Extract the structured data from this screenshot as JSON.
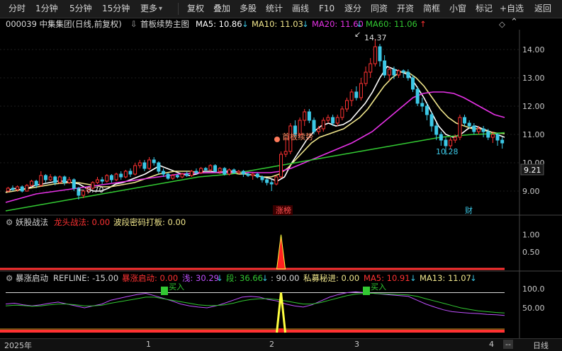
{
  "toolbar": {
    "left": [
      "分时",
      "1分钟",
      "5分钟",
      "15分钟",
      "更多"
    ],
    "more_arrow": "▾",
    "right": [
      "复权",
      "叠加",
      "多股",
      "统计",
      "画线",
      "F10",
      "逐分",
      "同资",
      "开资",
      "简框",
      "小窗",
      "标记",
      "+自选",
      "返回"
    ]
  },
  "main_title": {
    "stock": "000039 中集集团(日线,前复权)",
    "indicator": "首板续势主图",
    "ma5": "MA5: 10.86",
    "ma5_arrow": "↓",
    "ma10": "MA10: 11.03",
    "ma10_arrow": "↓",
    "ma20": "MA20: 11.60",
    "ma20_arrow": "↓",
    "ma60": "MA60: 11.06",
    "ma60_arrow": "↑"
  },
  "sub1_title": {
    "name": "妖股战法",
    "dragon": "龙头战法: 0.00",
    "wave": "波段密码打板: 0.00"
  },
  "sub2_title": {
    "name": "暴涨启动",
    "refline": "REFLINE: -15.00",
    "surge": "暴涨启动: 0.00",
    "shallow": "浅: 30.29",
    "shallow_arrow": "↓",
    "segment": "段: 36.66",
    "segment_arrow": "↓",
    "ninety": ": 90.00",
    "private": "私募秘进: 0.00",
    "ma5": "MA5: 10.91",
    "ma5_arrow": "↓",
    "ma13": "MA13: 11.07",
    "ma13_arrow": "↓"
  },
  "annotations": {
    "high": "14.37",
    "low_left": "8.70",
    "low_right": "10.28",
    "signal": "首板续势",
    "marker_limit": "涨榜",
    "marker_fin": "财",
    "current_price": "9.21",
    "buy_tag": "买入",
    "indicator_symbol": "◇"
  },
  "price_axis": [
    "14.00",
    "13.00",
    "12.00",
    "11.00",
    "10.00",
    "9.00"
  ],
  "sub1_axis": [
    "1.00",
    "0.50"
  ],
  "sub2_axis": [
    "100.0",
    "50.00"
  ],
  "dates": [
    "2025年",
    "1",
    "2",
    "3",
    "4"
  ],
  "date_right": "--",
  "daily_line_label": "日线",
  "colors": {
    "up": "#ff3232",
    "down": "#3cc8e6",
    "ma5": "#ffffff",
    "ma10": "#f0e68c",
    "ma20": "#e632e6",
    "ma60": "#32c832"
  },
  "chart_data": {
    "type": "candlestick",
    "price_ylim": [
      8.2,
      14.7
    ],
    "candles": [
      [
        9.0,
        9.1,
        9.15,
        8.95
      ],
      [
        9.1,
        9.05,
        9.2,
        9.0
      ],
      [
        9.05,
        9.15,
        9.2,
        8.98
      ],
      [
        9.15,
        9.0,
        9.2,
        8.95
      ],
      [
        9.0,
        9.2,
        9.25,
        8.98
      ],
      [
        9.2,
        9.35,
        9.4,
        9.15
      ],
      [
        9.35,
        9.2,
        9.4,
        9.1
      ],
      [
        9.2,
        9.55,
        9.7,
        9.15
      ],
      [
        9.55,
        9.4,
        9.6,
        9.3
      ],
      [
        9.4,
        9.5,
        9.6,
        9.35
      ],
      [
        9.5,
        9.3,
        9.55,
        9.2
      ],
      [
        9.3,
        9.5,
        9.55,
        9.25
      ],
      [
        9.5,
        9.3,
        9.55,
        9.2
      ],
      [
        9.3,
        9.4,
        9.5,
        9.25
      ],
      [
        9.4,
        9.1,
        9.45,
        9.0
      ],
      [
        9.1,
        8.85,
        9.15,
        8.7
      ],
      [
        8.85,
        9.0,
        9.05,
        8.75
      ],
      [
        9.0,
        9.1,
        9.15,
        8.9
      ],
      [
        9.1,
        9.3,
        9.35,
        9.05
      ],
      [
        9.3,
        9.4,
        9.5,
        9.25
      ],
      [
        9.4,
        9.35,
        9.5,
        9.25
      ],
      [
        9.35,
        9.55,
        9.6,
        9.3
      ],
      [
        9.55,
        9.4,
        9.6,
        9.3
      ],
      [
        9.4,
        9.6,
        9.65,
        9.35
      ],
      [
        9.6,
        9.5,
        9.7,
        9.4
      ],
      [
        9.5,
        9.7,
        9.75,
        9.45
      ],
      [
        9.7,
        9.6,
        9.8,
        9.5
      ],
      [
        9.6,
        9.9,
        10.0,
        9.55
      ],
      [
        9.9,
        10.0,
        10.1,
        9.8
      ],
      [
        10.0,
        9.8,
        10.1,
        9.7
      ],
      [
        9.8,
        10.1,
        10.2,
        9.75
      ],
      [
        10.1,
        10.0,
        10.2,
        9.9
      ],
      [
        10.0,
        9.7,
        10.05,
        9.6
      ],
      [
        9.7,
        9.6,
        9.8,
        9.5
      ],
      [
        9.6,
        9.45,
        9.65,
        9.4
      ],
      [
        9.45,
        9.55,
        9.6,
        9.4
      ],
      [
        9.55,
        9.5,
        9.6,
        9.45
      ],
      [
        9.5,
        9.6,
        9.65,
        9.45
      ],
      [
        9.6,
        9.55,
        9.7,
        9.5
      ],
      [
        9.55,
        9.7,
        9.75,
        9.5
      ],
      [
        9.7,
        9.65,
        9.8,
        9.6
      ],
      [
        9.65,
        9.8,
        9.85,
        9.6
      ],
      [
        9.8,
        9.75,
        9.85,
        9.7
      ],
      [
        9.75,
        9.9,
        9.95,
        9.7
      ],
      [
        9.9,
        9.7,
        9.95,
        9.65
      ],
      [
        9.7,
        9.8,
        9.85,
        9.6
      ],
      [
        9.8,
        9.6,
        9.85,
        9.55
      ],
      [
        9.6,
        9.75,
        9.8,
        9.55
      ],
      [
        9.75,
        9.65,
        9.8,
        9.6
      ],
      [
        9.65,
        9.7,
        9.75,
        9.6
      ],
      [
        9.7,
        9.6,
        9.75,
        9.5
      ],
      [
        9.6,
        9.55,
        9.65,
        9.5
      ],
      [
        9.55,
        9.6,
        9.65,
        9.4
      ],
      [
        9.6,
        9.5,
        9.65,
        9.45
      ],
      [
        9.5,
        9.4,
        9.55,
        9.3
      ],
      [
        9.4,
        9.3,
        9.45,
        9.2
      ],
      [
        9.3,
        9.25,
        9.4,
        9.0
      ],
      [
        9.25,
        9.5,
        9.55,
        9.2
      ],
      [
        9.5,
        10.3,
        10.4,
        9.45
      ],
      [
        10.3,
        10.4,
        10.9,
        10.2
      ],
      [
        10.4,
        11.3,
        11.4,
        10.3
      ],
      [
        11.3,
        11.0,
        11.5,
        10.9
      ],
      [
        11.0,
        11.5,
        11.6,
        10.9
      ],
      [
        11.5,
        11.8,
        11.9,
        11.3
      ],
      [
        11.8,
        11.5,
        11.9,
        11.4
      ],
      [
        11.5,
        11.1,
        11.6,
        11.0
      ],
      [
        11.1,
        11.2,
        11.3,
        11.0
      ],
      [
        11.2,
        11.5,
        11.6,
        11.1
      ],
      [
        11.5,
        11.6,
        11.7,
        11.4
      ],
      [
        11.6,
        11.4,
        11.7,
        11.3
      ],
      [
        11.4,
        11.6,
        11.7,
        11.3
      ],
      [
        11.6,
        11.9,
        12.0,
        11.5
      ],
      [
        11.9,
        12.2,
        12.3,
        11.8
      ],
      [
        12.2,
        12.5,
        12.6,
        12.0
      ],
      [
        12.5,
        12.3,
        12.7,
        12.2
      ],
      [
        12.3,
        12.8,
        13.0,
        12.2
      ],
      [
        12.8,
        13.2,
        13.4,
        12.7
      ],
      [
        13.2,
        13.5,
        13.7,
        13.0
      ],
      [
        13.5,
        14.1,
        14.37,
        13.4
      ],
      [
        14.1,
        13.6,
        14.2,
        13.4
      ],
      [
        13.6,
        13.1,
        13.8,
        13.0
      ],
      [
        13.1,
        13.3,
        13.4,
        12.9
      ],
      [
        13.3,
        13.1,
        13.4,
        12.95
      ],
      [
        13.1,
        13.25,
        13.3,
        13.0
      ],
      [
        13.25,
        13.2,
        13.3,
        13.0
      ],
      [
        13.2,
        13.0,
        13.3,
        12.9
      ],
      [
        13.0,
        12.6,
        13.1,
        12.5
      ],
      [
        12.6,
        12.1,
        12.7,
        12.0
      ],
      [
        12.1,
        12.0,
        12.3,
        11.8
      ],
      [
        12.0,
        11.7,
        12.1,
        11.5
      ],
      [
        11.7,
        11.3,
        11.8,
        11.1
      ],
      [
        11.3,
        11.0,
        11.4,
        10.8
      ],
      [
        11.0,
        10.8,
        11.1,
        10.6
      ],
      [
        10.8,
        10.6,
        10.9,
        10.28
      ],
      [
        10.6,
        10.8,
        10.9,
        10.5
      ],
      [
        10.8,
        10.9,
        11.0,
        10.7
      ],
      [
        10.9,
        11.6,
        11.7,
        10.8
      ],
      [
        11.6,
        11.4,
        11.7,
        11.3
      ],
      [
        11.4,
        11.3,
        11.5,
        11.2
      ],
      [
        11.3,
        11.1,
        11.4,
        11.0
      ],
      [
        11.1,
        11.2,
        11.3,
        11.0
      ],
      [
        11.2,
        11.1,
        11.3,
        10.9
      ],
      [
        11.1,
        10.9,
        11.2,
        10.8
      ],
      [
        10.9,
        11.0,
        11.1,
        10.7
      ],
      [
        11.0,
        10.8,
        11.05,
        10.6
      ],
      [
        10.8,
        10.7,
        10.9,
        10.5
      ]
    ],
    "ma_series": {
      "MA5": [
        8.95,
        9.1,
        9.05,
        9.1,
        9.2,
        9.25,
        9.3,
        9.35,
        9.35,
        9.3,
        9.25,
        9.1,
        9.0,
        9.0,
        9.1,
        9.25,
        9.3,
        9.4,
        9.5,
        9.6,
        9.75,
        9.9,
        9.8,
        9.7,
        9.6,
        9.55,
        9.6,
        9.7,
        9.7,
        9.65,
        9.7,
        9.7,
        9.65,
        9.6,
        9.55,
        9.5,
        9.45,
        9.35,
        9.5,
        10.0,
        10.4,
        10.8,
        11.1,
        11.3,
        11.4,
        11.3,
        11.35,
        11.5,
        11.8,
        12.1,
        12.5,
        13.0,
        13.4,
        13.3,
        13.2,
        13.1,
        12.7,
        12.3,
        11.8,
        11.3,
        11.0,
        10.9,
        11.0,
        11.2,
        11.3,
        11.2,
        11.1,
        11.0,
        10.9
      ],
      "MA10": [
        8.95,
        9.0,
        9.05,
        9.1,
        9.15,
        9.2,
        9.25,
        9.28,
        9.3,
        9.3,
        9.25,
        9.2,
        9.15,
        9.15,
        9.2,
        9.25,
        9.3,
        9.4,
        9.5,
        9.6,
        9.65,
        9.7,
        9.7,
        9.7,
        9.65,
        9.65,
        9.65,
        9.65,
        9.65,
        9.6,
        9.6,
        9.55,
        9.5,
        9.5,
        9.6,
        9.8,
        10.1,
        10.4,
        10.7,
        10.9,
        11.0,
        11.1,
        11.2,
        11.4,
        11.6,
        11.9,
        12.3,
        12.7,
        13.0,
        13.2,
        13.2,
        13.0,
        12.7,
        12.3,
        11.9,
        11.6,
        11.4,
        11.3,
        11.2,
        11.2,
        11.1,
        11.05,
        11.03
      ],
      "MA20": [
        8.6,
        8.7,
        8.8,
        8.9,
        8.95,
        9.0,
        9.05,
        9.1,
        9.15,
        9.2,
        9.25,
        9.3,
        9.35,
        9.4,
        9.45,
        9.5,
        9.55,
        9.6,
        9.62,
        9.64,
        9.65,
        9.66,
        9.66,
        9.66,
        9.66,
        9.65,
        9.65,
        9.7,
        9.8,
        9.95,
        10.1,
        10.25,
        10.4,
        10.55,
        10.7,
        10.9,
        11.1,
        11.4,
        11.7,
        12.0,
        12.3,
        12.45,
        12.5,
        12.5,
        12.45,
        12.3,
        12.1,
        11.9,
        11.7,
        11.6
      ],
      "MA60": [
        8.3,
        8.4,
        8.5,
        8.6,
        8.7,
        8.8,
        8.9,
        9.0,
        9.1,
        9.2,
        9.3,
        9.4,
        9.5,
        9.55,
        9.6,
        9.7,
        9.8,
        9.9,
        10.0,
        10.1,
        10.2,
        10.3,
        10.4,
        10.5,
        10.6,
        10.7,
        10.8,
        10.9,
        10.95,
        11.0,
        11.02,
        11.06
      ]
    },
    "sub1_ylim": [
      0,
      1.2
    ],
    "sub1_spike_x_index": 58,
    "sub1_spike_value": 1.0,
    "sub2_ylim": [
      -15,
      115
    ],
    "sub2_ref_level": 90,
    "sub2_spike_x_index": 58,
    "sub2_spike_value": 90,
    "sub2_shallow": [
      60,
      62,
      58,
      55,
      58,
      62,
      65,
      60,
      55,
      50,
      55,
      60,
      70,
      75,
      80,
      85,
      88,
      82,
      75,
      68,
      60,
      55,
      52,
      50,
      55,
      62,
      70,
      78,
      80,
      78,
      72,
      68,
      60,
      55,
      52,
      58,
      68,
      78,
      85,
      90,
      92,
      90,
      88,
      86,
      84,
      82,
      80,
      70,
      60,
      52,
      45,
      40,
      38,
      36,
      35,
      33,
      32,
      30
    ],
    "sub2_segment": [
      55,
      57,
      56,
      54,
      55,
      58,
      60,
      60,
      58,
      55,
      55,
      57,
      62,
      66,
      70,
      74,
      78,
      78,
      74,
      70,
      66,
      62,
      58,
      56,
      56,
      58,
      62,
      68,
      72,
      74,
      74,
      72,
      68,
      64,
      60,
      60,
      64,
      70,
      76,
      82,
      86,
      88,
      88,
      87,
      86,
      85,
      84,
      80,
      74,
      68,
      62,
      56,
      50,
      46,
      42,
      40,
      38,
      36.66
    ]
  }
}
